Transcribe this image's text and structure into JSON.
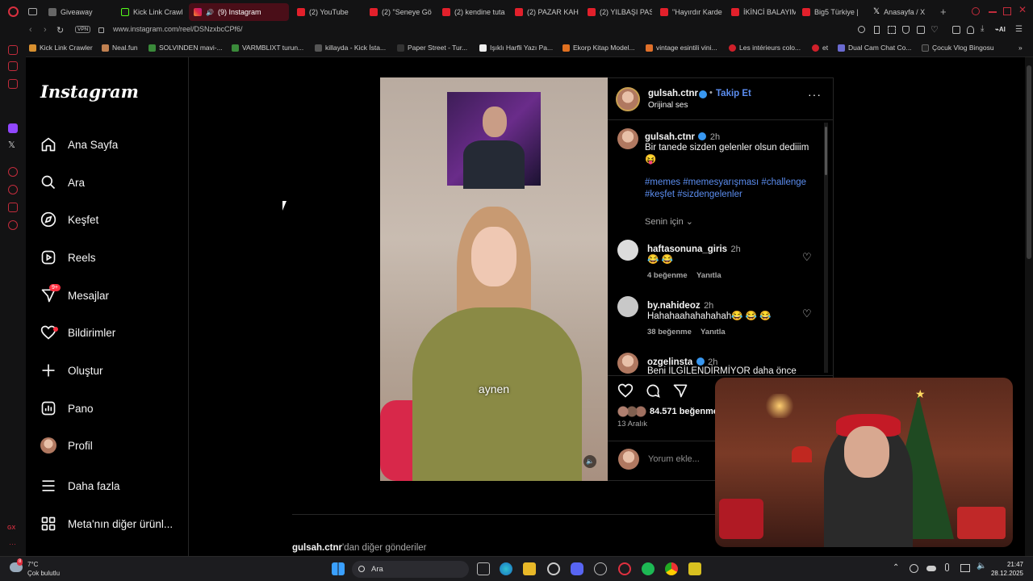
{
  "browser": {
    "tabs": [
      {
        "label": "Giveaway",
        "icon": "discord-icon"
      },
      {
        "label": "Kick Link Crawl",
        "icon": "kick-icon"
      },
      {
        "label": "(9) Instagram",
        "icon": "instagram-icon",
        "active": true
      },
      {
        "label": "(2) YouTube",
        "icon": "youtube-icon"
      },
      {
        "label": "(2) \"Seneye Gö",
        "icon": "youtube-icon"
      },
      {
        "label": "(2) kendine tuta",
        "icon": "youtube-icon"
      },
      {
        "label": "(2) PAZAR KAH",
        "icon": "youtube-icon"
      },
      {
        "label": "(2) YILBAŞI PAS",
        "icon": "youtube-icon"
      },
      {
        "label": "\"Hayırdır Karde",
        "icon": "youtube-icon"
      },
      {
        "label": "İKİNCİ BALAYIM",
        "icon": "youtube-icon"
      },
      {
        "label": "Big5 Türkiye | ",
        "icon": "youtube-icon"
      },
      {
        "label": "Anasayfa / X",
        "icon": "x-icon"
      }
    ],
    "vpn": "VPN",
    "url": "www.instagram.com/reel/DSNzxbcCPf6/",
    "bookmarks": [
      "Kick Link Crawler",
      "Neal.fun",
      "SOLVINDEN mavi-...",
      "VARMBLIXT turun...",
      "killayda - Kick İsta...",
      "Paper Street - Tur...",
      "Işıklı Harfli Yazı Pa...",
      "Ekorp Kitap Model...",
      "vintage esintili vini...",
      "Les intérieurs colo...",
      "et",
      "Dual Cam Chat Co...",
      "Çocuk Vlog Bingosu"
    ]
  },
  "instagram": {
    "logo": "Instagram",
    "nav": [
      {
        "label": "Ana Sayfa",
        "icon": "home-icon"
      },
      {
        "label": "Ara",
        "icon": "search-icon"
      },
      {
        "label": "Keşfet",
        "icon": "compass-icon"
      },
      {
        "label": "Reels",
        "icon": "reels-icon"
      },
      {
        "label": "Mesajlar",
        "icon": "messenger-icon",
        "badge": "9+"
      },
      {
        "label": "Bildirimler",
        "icon": "heart-icon"
      },
      {
        "label": "Oluştur",
        "icon": "plus-icon"
      },
      {
        "label": "Pano",
        "icon": "dashboard-icon"
      },
      {
        "label": "Profil",
        "icon": "profile-avatar"
      },
      {
        "label": "Daha fazla",
        "icon": "menu-icon"
      },
      {
        "label": "Meta'nın diğer ürünl...",
        "icon": "apps-icon"
      }
    ],
    "reel": {
      "subtitle": "aynen",
      "author": "gulsah.ctnr",
      "follow": "Takip Et",
      "audio": "Orijinal ses",
      "caption_time": "2h",
      "caption": "Bir tanede sizden gelenler olsun dediiim 😝",
      "hashtags_line1": "#memes #memesyarışması #challenge",
      "hashtags_line2": "#keşfet #sizdengelenler",
      "for_you": "Senin için",
      "likes": "84.571 beğenme",
      "date": "13 Aralık",
      "comment_placeholder": "Yorum ekle..."
    },
    "comments": [
      {
        "user": "haftasonuna_giris",
        "time": "2h",
        "text": "😂 😂",
        "likes": "4 beğenme",
        "reply": "Yanıtla"
      },
      {
        "user": "by.nahideoz",
        "time": "2h",
        "text": "Hahahaahahahahah😂 😂 😂",
        "likes": "38 beğenme",
        "reply": "Yanıtla"
      },
      {
        "user": "ozgelinsta",
        "time": "2h",
        "text": "Beni İLGİLENDİRMİYOR daha önce",
        "verified": true
      }
    ],
    "more_from_user": "gulsah.ctnr",
    "more_from_suffix": "'dan diğer gönderiler"
  },
  "taskbar": {
    "weather_temp": "7°C",
    "weather_desc": "Çok bulutlu",
    "search": "Ara",
    "time": "21:47",
    "date": "28.12.2025",
    "notification_badge": "8"
  },
  "colors": {
    "accent_blue": "#5b8def",
    "opera_red": "#c22c3c",
    "ig_bg": "#000000"
  }
}
